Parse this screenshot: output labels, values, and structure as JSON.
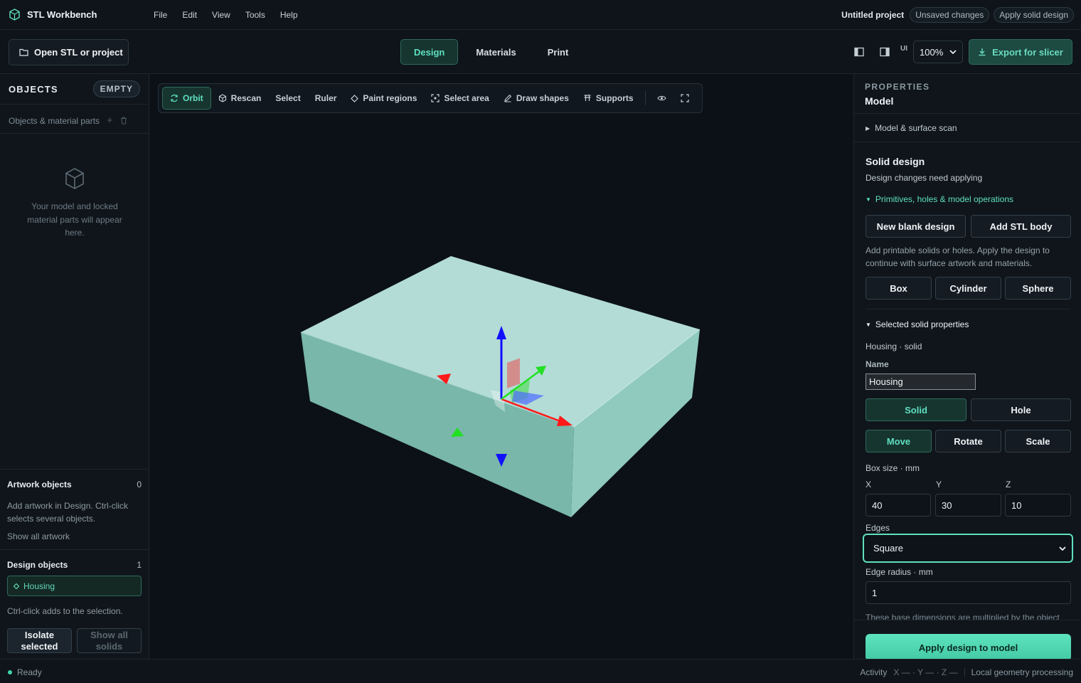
{
  "app": {
    "title": "STL Workbench",
    "menu": [
      "File",
      "Edit",
      "View",
      "Tools",
      "Help"
    ]
  },
  "header": {
    "project": "Untitled project",
    "unsaved": "Unsaved changes",
    "apply_solid": "Apply solid design"
  },
  "toolbar": {
    "open_label": "Open STL or project",
    "tabs": [
      "Design",
      "Materials",
      "Print"
    ],
    "ui_label": "UI",
    "zoom": "100%",
    "export_label": "Export for slicer"
  },
  "objects_panel": {
    "title": "OBJECTS",
    "badge": "EMPTY",
    "sublabel": "Objects & material parts",
    "empty_hint": "Your model and locked material parts will appear here.",
    "artwork": {
      "title": "Artwork objects",
      "count": "0",
      "hint": "Add artwork in Design. Ctrl-click selects several objects.",
      "show_all": "Show all artwork"
    },
    "design": {
      "title": "Design objects",
      "count": "1",
      "item": "Housing",
      "hint": "Ctrl-click adds to the selection.",
      "isolate": "Isolate selected",
      "show_all": "Show all solids"
    }
  },
  "viewport_tools": [
    "Orbit",
    "Rescan",
    "Select",
    "Ruler",
    "Paint regions",
    "Select area",
    "Draw shapes",
    "Supports"
  ],
  "properties": {
    "title": "PROPERTIES",
    "subtitle": "Model",
    "model_scan": "Model & surface scan",
    "solid_design": "Solid design",
    "needs_apply": "Design changes need applying",
    "primitives_toggle": "Primitives, holes & model operations",
    "new_blank": "New blank design",
    "add_stl": "Add STL body",
    "primitives_hint": "Add printable solids or holes. Apply the design to continue with surface artwork and materials.",
    "primitives": [
      "Box",
      "Cylinder",
      "Sphere"
    ],
    "selected_toggle": "Selected solid properties",
    "selected_desc": "Housing · solid",
    "name_label": "Name",
    "name_value": "Housing",
    "modes": [
      "Solid",
      "Hole"
    ],
    "transforms": [
      "Move",
      "Rotate",
      "Scale"
    ],
    "box_size_label": "Box size · mm",
    "axes": [
      "X",
      "Y",
      "Z"
    ],
    "box_size": [
      "40",
      "30",
      "10"
    ],
    "edges_label": "Edges",
    "edges_value": "Square",
    "edge_radius_label": "Edge radius · mm",
    "edge_radius_value": "1",
    "footnote": "These base dimensions are multiplied by the object",
    "apply_label": "Apply design to model"
  },
  "status": {
    "ready": "Ready",
    "activity": "Activity",
    "coords": "X — · Y — · Z —",
    "processing": "Local geometry processing"
  },
  "colors": {
    "accent": "#5ee0c0",
    "apply_button": "#4fd6b0",
    "model": "#9fd6cc"
  }
}
